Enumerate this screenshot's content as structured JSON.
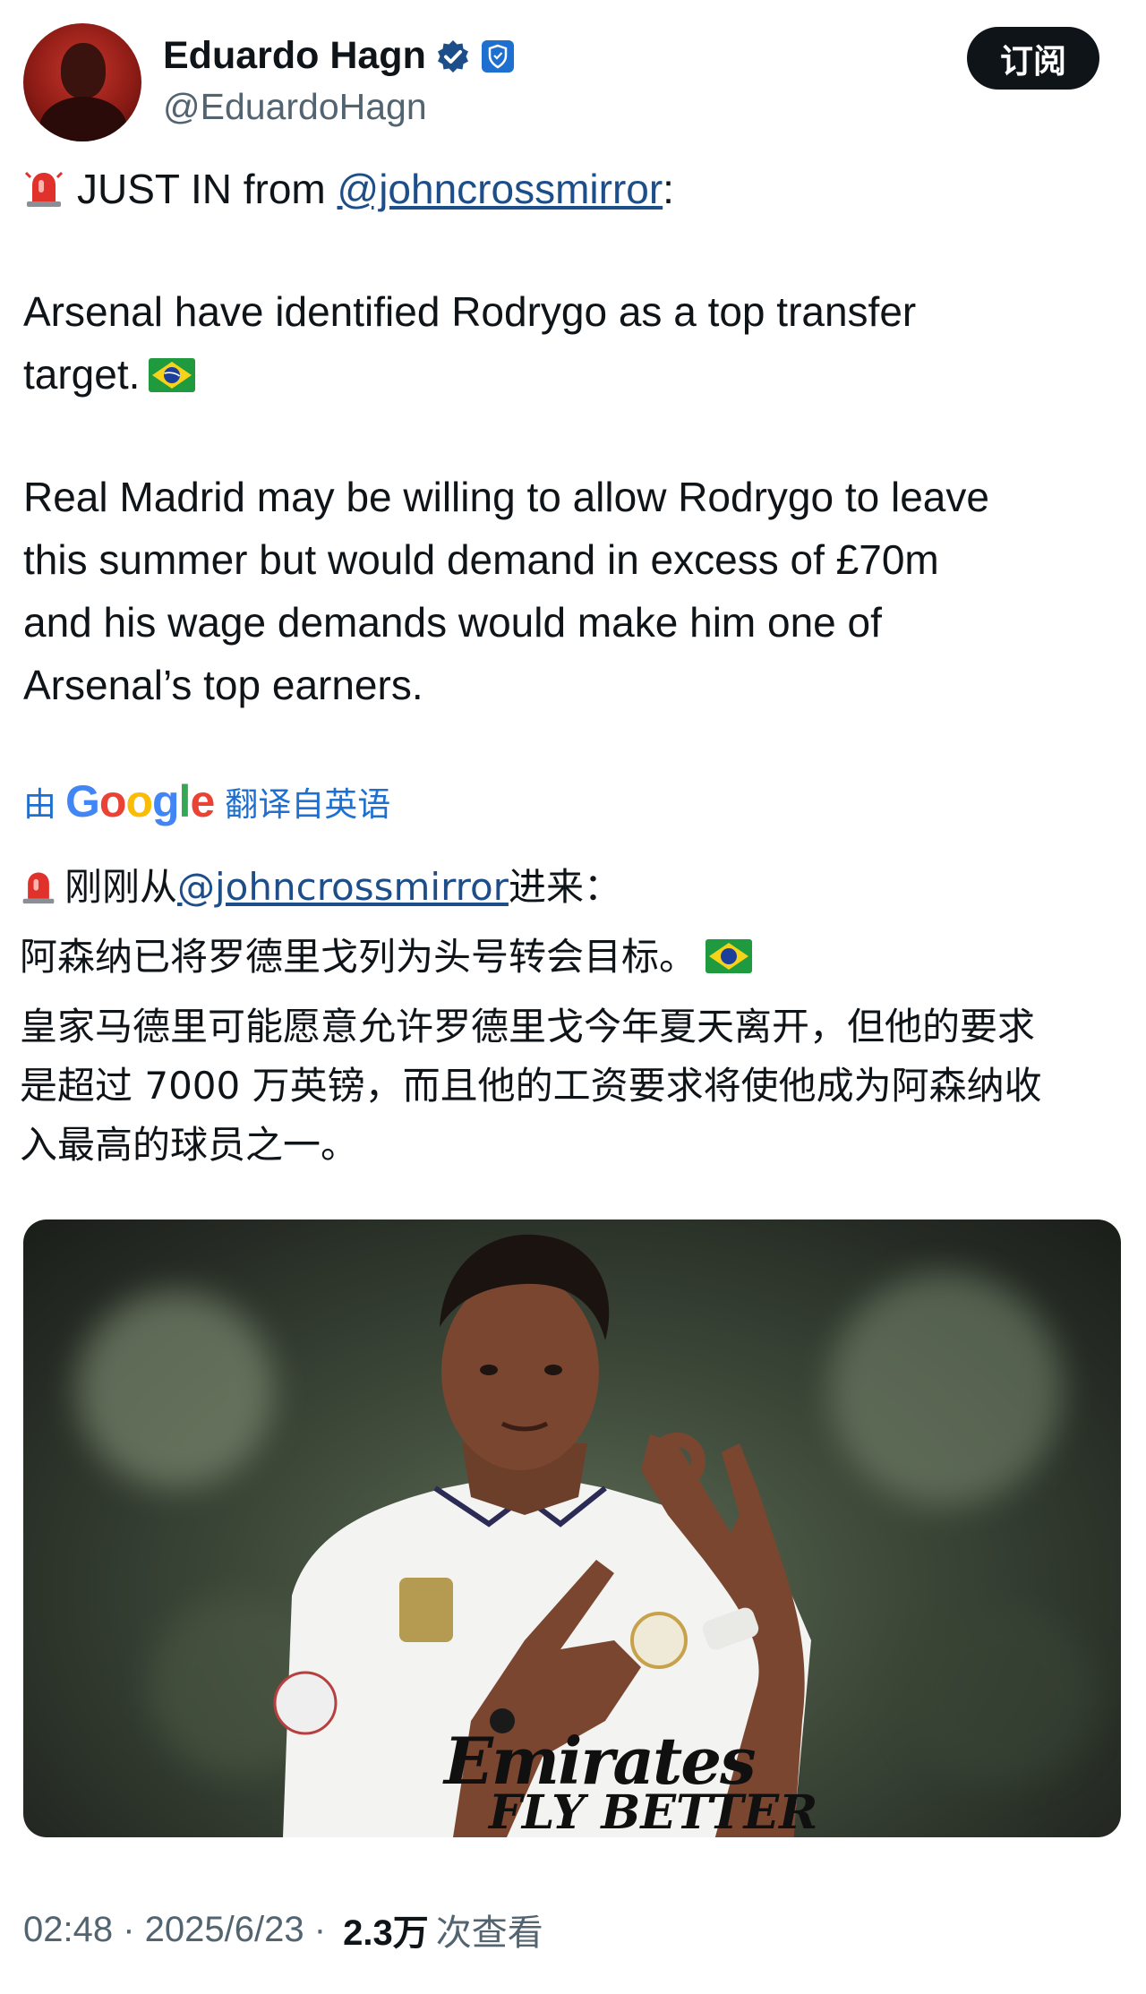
{
  "author": {
    "display_name": "Eduardo Hagn",
    "handle": "@EduardoHagn",
    "verified_icon": "verified-badge-icon",
    "affiliate_icon": "shield-badge-icon"
  },
  "subscribe_label": "订阅",
  "tweet": {
    "line1_prefix": "JUST IN from ",
    "line1_mention": "@johncrossmirror",
    "line1_suffix": ":",
    "para2_line1": "Arsenal have identified Rodrygo as a top transfer",
    "para2_line2": "target.",
    "para3_line1": "Real Madrid may be willing to allow Rodrygo to leave",
    "para3_line2": "this summer but would demand in excess of £70m",
    "para3_line3": "and his wage demands would make him one of",
    "para3_line4": "Arsenal’s top earners."
  },
  "translation": {
    "by": "由",
    "provider": "Google",
    "from": "翻译自英语",
    "line1_prefix": "刚刚从",
    "line1_mention": "@johncrossmirror",
    "line1_suffix": "进来：",
    "line2": "阿森纳已将罗德里戈列为头号转会目标。",
    "line3": "皇家马德里可能愿意允许罗德里戈今年夏天离开，但他的要求",
    "line4": "是超过 7000 万英镑，而且他的工资要求将使他成为阿森纳收",
    "line5": "入最高的球员之一。"
  },
  "media": {
    "shirt_text_1": "Emirates",
    "shirt_text_2": "FLY BETTER"
  },
  "meta": {
    "time": "02:48",
    "sep1": " · ",
    "date": "2025/6/23",
    "sep2": " · ",
    "views": "2.3万",
    "views_label": "次查看"
  },
  "colors": {
    "link": "#1d4e89",
    "muted": "#536471",
    "verified": "#1d9bf0",
    "button_bg": "#0f1419"
  }
}
